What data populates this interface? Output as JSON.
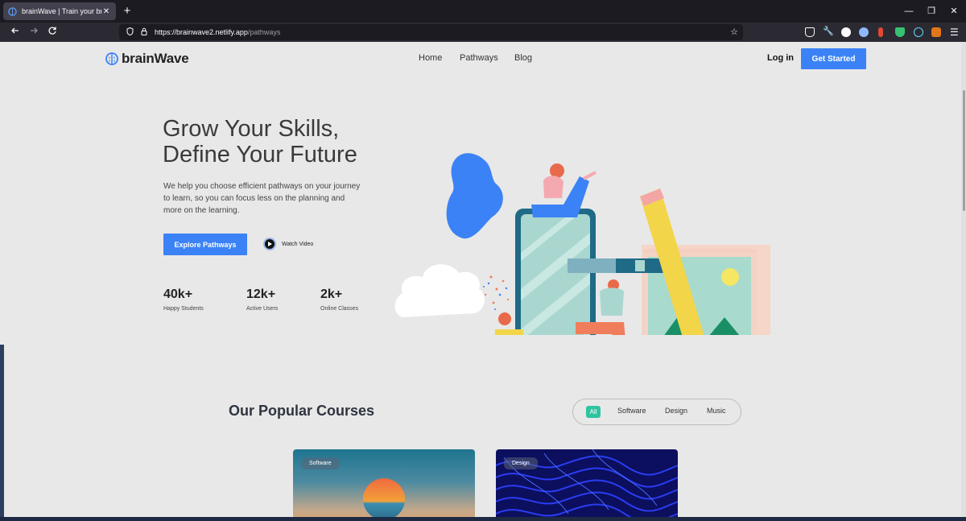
{
  "browser": {
    "tab_title": "brainWave | Train your brain",
    "tab_close": "✕",
    "new_tab": "+",
    "url_host": "https://brainwave2.netlify.app",
    "url_path": "/pathways",
    "back_icon": "arrow-left",
    "forward_icon": "arrow-right",
    "reload_icon": "reload",
    "minimize": "—",
    "restore": "❐",
    "close": "✕"
  },
  "site": {
    "logo_text": "brainWave",
    "nav": [
      "Home",
      "Pathways",
      "Blog"
    ],
    "login": "Log in",
    "get_started": "Get Started",
    "accent_color": "#3b82f6"
  },
  "hero": {
    "title_line1": "Grow Your Skills,",
    "title_line2": "Define Your Future",
    "description": "We help you choose efficient pathways on your journey to learn, so you can focus less on the planning and more on the learning.",
    "explore_button": "Explore Pathways",
    "watch_video": "Watch Video",
    "stats": [
      {
        "value": "40k+",
        "label": "Happy Students"
      },
      {
        "value": "12k+",
        "label": "Active Users"
      },
      {
        "value": "2k+",
        "label": "Online Classes"
      }
    ]
  },
  "courses": {
    "title": "Our Popular Courses",
    "filters": [
      "All",
      "Software",
      "Design",
      "Music"
    ],
    "active_filter": "All",
    "cards": [
      {
        "tag": "Software"
      },
      {
        "tag": "Design"
      }
    ]
  }
}
